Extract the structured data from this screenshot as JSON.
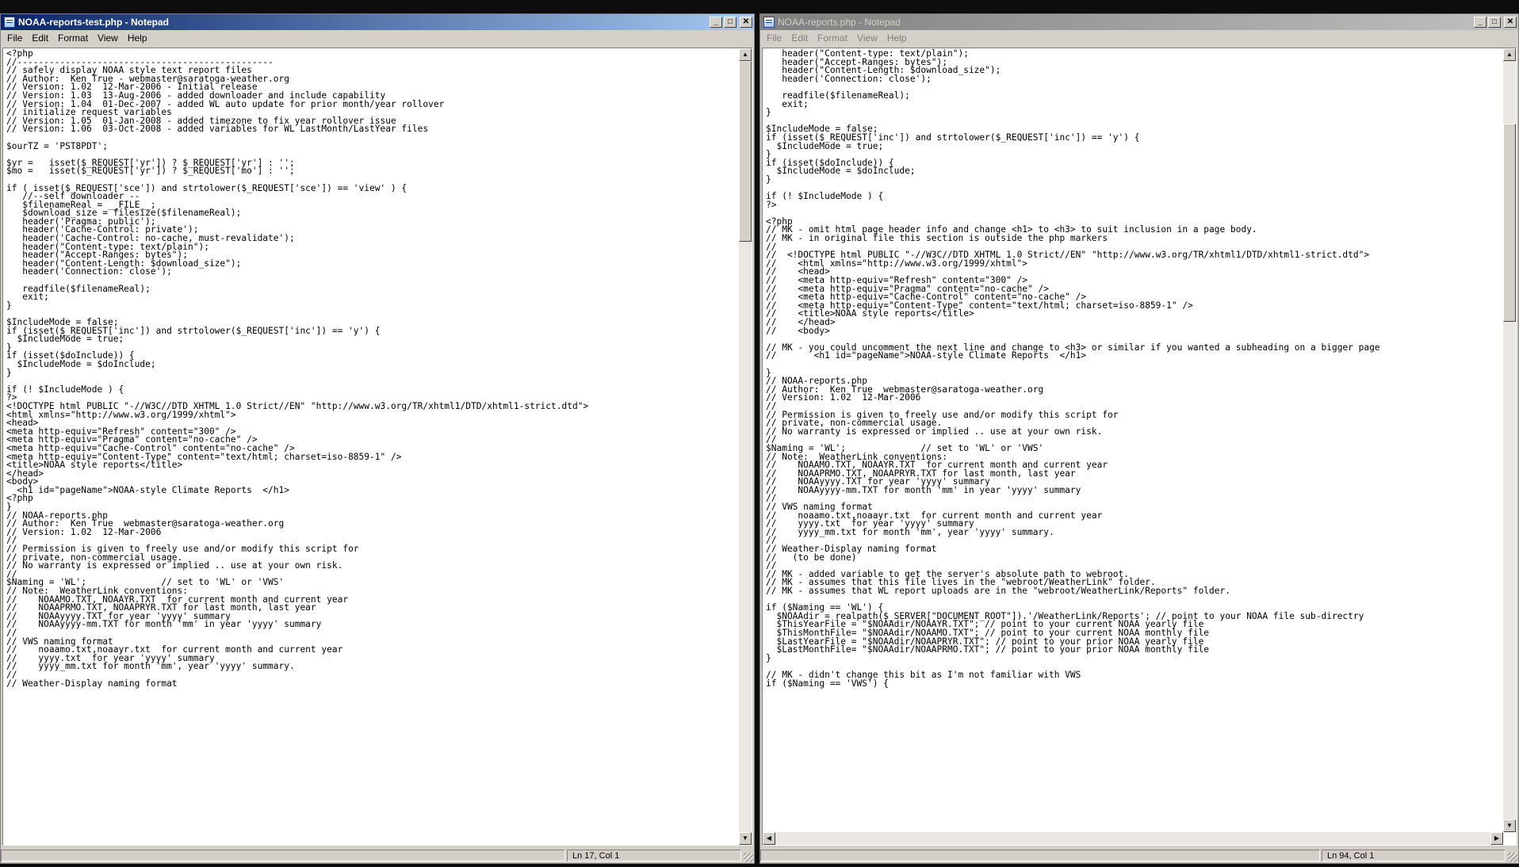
{
  "left_window": {
    "title": "NOAA-reports-test.php - Notepad",
    "menu": [
      "File",
      "Edit",
      "Format",
      "View",
      "Help"
    ],
    "status": "Ln 17, Col 1",
    "lines": [
      "<?php",
      "//------------------------------------------------",
      "// safely display NOAA style text report files",
      "// Author:  Ken True - webmaster@saratoga-weather.org",
      "// Version: 1.02  12-Mar-2006 - Initial release",
      "// Version: 1.03  13-Aug-2006 - added downloader and include capability",
      "// Version: 1.04  01-Dec-2007 - added WL auto update for prior month/year rollover",
      "// initialize request variables",
      "// Version: 1.05  01-Jan-2008 - added timezone to fix year rollover issue",
      "// Version: 1.06  03-Oct-2008 - added variables for WL LastMonth/LastYear files",
      "",
      "$ourTZ = 'PST8PDT';",
      "",
      "$yr =   isset($_REQUEST['yr']) ? $_REQUEST['yr'] : '';",
      "$mo =   isset($_REQUEST['yr']) ? $_REQUEST['mo'] : '';",
      "",
      "if ( isset($_REQUEST['sce']) and strtolower($_REQUEST['sce']) == 'view' ) {",
      "   //--self downloader --",
      "   $filenameReal = __FILE__;",
      "   $download_size = filesize($filenameReal);",
      "   header('Pragma: public');",
      "   header('Cache-Control: private');",
      "   header('Cache-Control: no-cache, must-revalidate');",
      "   header(\"Content-type: text/plain\");",
      "   header(\"Accept-Ranges: bytes\");",
      "   header(\"Content-Length: $download_size\");",
      "   header('Connection: close');",
      "",
      "   readfile($filenameReal);",
      "   exit;",
      "}",
      "",
      "$IncludeMode = false;",
      "if (isset($_REQUEST['inc']) and strtolower($_REQUEST['inc']) == 'y') {",
      "  $IncludeMode = true;",
      "}",
      "if (isset($doInclude)) {",
      "  $IncludeMode = $doInclude;",
      "}",
      "",
      "if (! $IncludeMode ) {",
      "?>",
      "<!DOCTYPE html PUBLIC \"-//W3C//DTD XHTML 1.0 Strict//EN\" \"http://www.w3.org/TR/xhtml1/DTD/xhtml1-strict.dtd\">",
      "<html xmlns=\"http://www.w3.org/1999/xhtml\">",
      "<head>",
      "<meta http-equiv=\"Refresh\" content=\"300\" />",
      "<meta http-equiv=\"Pragma\" content=\"no-cache\" />",
      "<meta http-equiv=\"Cache-Control\" content=\"no-cache\" />",
      "<meta http-equiv=\"Content-Type\" content=\"text/html; charset=iso-8859-1\" />",
      "<title>NOAA style reports</title>",
      "</head>",
      "<body>",
      "  <h1 id=\"pageName\">NOAA-style Climate Reports  </h1>",
      "<?php",
      "}",
      "// NOAA-reports.php",
      "// Author:  Ken True  webmaster@saratoga-weather.org",
      "// Version: 1.02  12-Mar-2006",
      "//",
      "// Permission is given to freely use and/or modify this script for",
      "// private, non-commercial usage.",
      "// No warranty is expressed or implied .. use at your own risk.",
      "//",
      "$Naming = 'WL';              // set to 'WL' or 'VWS'",
      "// Note:  WeatherLink conventions:",
      "//    NOAAMO.TXT, NOAAYR.TXT  for current month and current year",
      "//    NOAAPRMO.TXT, NOAAPRYR.TXT for last month, last year",
      "//    NOAAyyyy.TXT for year 'yyyy' summary",
      "//    NOAAyyyy-mm.TXT for month 'mm' in year 'yyyy' summary",
      "//",
      "// VWS naming format",
      "//    noaamo.txt,noaayr.txt  for current month and current year",
      "//    yyyy.txt  for year 'yyyy' summary",
      "//    yyyy_mm.txt for month 'mm', year 'yyyy' summary.",
      "//",
      "// Weather-Display naming format"
    ]
  },
  "right_window": {
    "title": "NOAA-reports.php - Notepad",
    "menu": [
      "File",
      "Edit",
      "Format",
      "View",
      "Help"
    ],
    "status": "Ln 94, Col 1",
    "lines": [
      "   header(\"Content-type: text/plain\");",
      "   header(\"Accept-Ranges: bytes\");",
      "   header(\"Content-Length: $download_size\");",
      "   header('Connection: close');",
      "",
      "   readfile($filenameReal);",
      "   exit;",
      "}",
      "",
      "$IncludeMode = false;",
      "if (isset($_REQUEST['inc']) and strtolower($_REQUEST['inc']) == 'y') {",
      "  $IncludeMode = true;",
      "}",
      "if (isset($doInclude)) {",
      "  $IncludeMode = $doInclude;",
      "}",
      "",
      "if (! $IncludeMode ) {",
      "?>",
      "",
      "<?php",
      "// MK - omit html page header info and change <h1> to <h3> to suit inclusion in a page body.",
      "// MK - in original file this section is outside the php markers",
      "//",
      "//  <!DOCTYPE html PUBLIC \"-//W3C//DTD XHTML 1.0 Strict//EN\" \"http://www.w3.org/TR/xhtml1/DTD/xhtml1-strict.dtd\">",
      "//    <html xmlns=\"http://www.w3.org/1999/xhtml\">",
      "//    <head>",
      "//    <meta http-equiv=\"Refresh\" content=\"300\" />",
      "//    <meta http-equiv=\"Pragma\" content=\"no-cache\" />",
      "//    <meta http-equiv=\"Cache-Control\" content=\"no-cache\" />",
      "//    <meta http-equiv=\"Content-Type\" content=\"text/html; charset=iso-8859-1\" />",
      "//    <title>NOAA style reports</title>",
      "//    </head>",
      "//    <body>",
      "",
      "// MK - you could uncomment the next line and change to <h3> or similar if you wanted a subheading on a bigger page",
      "//       <h1 id=\"pageName\">NOAA-style Climate Reports  </h1>",
      "",
      "}",
      "// NOAA-reports.php",
      "// Author:  Ken True  webmaster@saratoga-weather.org",
      "// Version: 1.02  12-Mar-2006",
      "//",
      "// Permission is given to freely use and/or modify this script for",
      "// private, non-commercial usage.",
      "// No warranty is expressed or implied .. use at your own risk.",
      "//",
      "$Naming = 'WL';              // set to 'WL' or 'VWS'",
      "// Note:  WeatherLink conventions:",
      "//    NOAAMO.TXT, NOAAYR.TXT  for current month and current year",
      "//    NOAAPRMO.TXT, NOAAPRYR.TXT for last month, last year",
      "//    NOAAyyyy.TXT for year 'yyyy' summary",
      "//    NOAAyyyy-mm.TXT for month 'mm' in year 'yyyy' summary",
      "//",
      "// VWS naming format",
      "//    noaamo.txt,noaayr.txt  for current month and current year",
      "//    yyyy.txt  for year 'yyyy' summary",
      "//    yyyy_mm.txt for month 'mm', year 'yyyy' summary.",
      "//",
      "// Weather-Display naming format",
      "//   (to be done)",
      "//",
      "// MK - added variable to get the server's absolute path to webroot.",
      "// MK - assumes that this file lives in the \"webroot/WeatherLink\" folder.",
      "// MK - assumes that WL report uploads are in the \"webroot/WeatherLink/Reports\" folder.",
      "",
      "if ($Naming == 'WL') {",
      "  $NOAAdir = realpath($_SERVER[\"DOCUMENT_ROOT\"]).'/WeatherLink/Reports'; // point to your NOAA file sub-directry",
      "  $ThisYearFile = \"$NOAAdir/NOAAYR.TXT\"; // point to your current NOAA yearly file",
      "  $ThisMonthFile= \"$NOAAdir/NOAAMO.TXT\"; // point to your current NOAA monthly file",
      "  $LastYearFile = \"$NOAAdir/NOAAPRYR.TXT\"; // point to your prior NOAA yearly file",
      "  $LastMonthFile= \"$NOAAdir/NOAAPRMO.TXT\"; // point to your prior NOAA monthly file",
      "}",
      "",
      "// MK - didn't change this bit as I'm not familiar with VWS",
      "if ($Naming == 'VWS') {"
    ]
  }
}
